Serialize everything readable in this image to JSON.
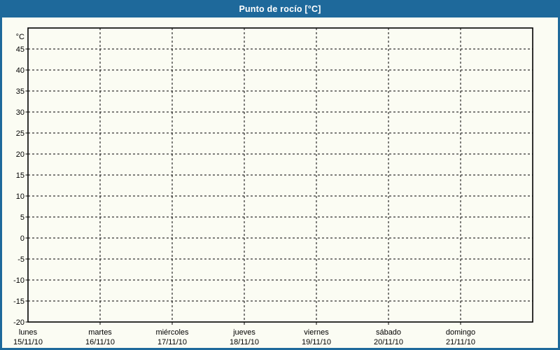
{
  "window": {
    "title": "Punto de rocío [°C]",
    "colors": {
      "header_bg": "#1e699b",
      "header_text": "#ffffff",
      "frame_border": "#1e699b",
      "page_bg": "#fbfcf3",
      "grid": "#000000",
      "axis": "#000000",
      "text": "#000000"
    }
  },
  "chart_data": {
    "type": "line",
    "title": "Punto de rocío [°C]",
    "xlabel": "",
    "ylabel": "°C",
    "ylim": [
      -20,
      50
    ],
    "grid": "dashed",
    "legend": "none",
    "y_axis": {
      "unit": "°C",
      "min": -20,
      "max": 50,
      "step": 5,
      "labeled_ticks": [
        45,
        40,
        35,
        30,
        25,
        20,
        15,
        10,
        5,
        0,
        -5,
        -10,
        -15,
        -20
      ]
    },
    "x_axis": {
      "categories": [
        {
          "day": "lunes",
          "date": "15/11/10"
        },
        {
          "day": "martes",
          "date": "16/11/10"
        },
        {
          "day": "miércoles",
          "date": "17/11/10"
        },
        {
          "day": "jueves",
          "date": "18/11/10"
        },
        {
          "day": "viernes",
          "date": "19/11/10"
        },
        {
          "day": "sábado",
          "date": "20/11/10"
        },
        {
          "day": "domingo",
          "date": "21/11/10"
        }
      ]
    },
    "series": []
  }
}
